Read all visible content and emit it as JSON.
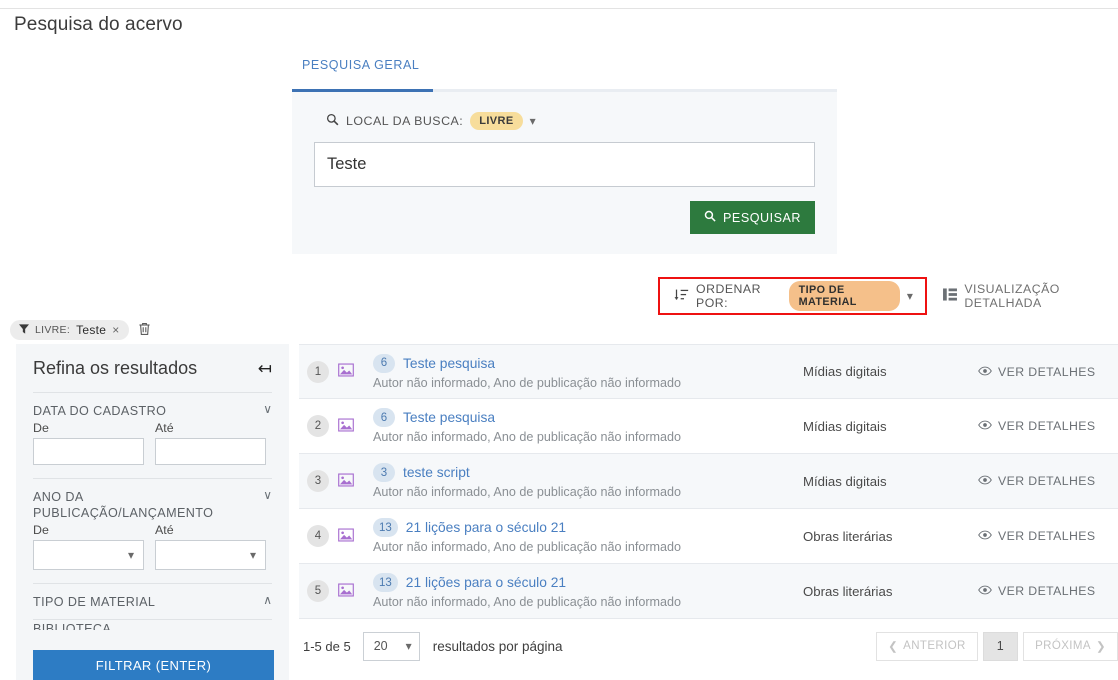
{
  "page": {
    "title": "Pesquisa do acervo"
  },
  "search": {
    "tabs": [
      {
        "label": "PESQUISA GERAL",
        "active": true
      }
    ],
    "local_label": "LOCAL DA BUSCA:",
    "local_value": "LIVRE",
    "query_value": "Teste",
    "submit_label": "PESQUISAR"
  },
  "sortbar": {
    "order_label": "ORDENAR POR:",
    "order_value": "TIPO DE MATERIAL",
    "view_label": "VISUALIZAÇÃO DETALHADA",
    "highlight_color": "#ee1111"
  },
  "applied_filter": {
    "key": "LIVRE:",
    "value": "Teste",
    "remove": "×",
    "clear_all_icon": "trash-icon"
  },
  "sidebar": {
    "title": "Refina os resultados",
    "facets": [
      {
        "title": "DATA DO CADASTRO",
        "state": "expanded",
        "chevron": "∨",
        "from_label": "De",
        "to_label": "Até",
        "from_value": "",
        "to_value": "",
        "type": "date"
      },
      {
        "title": "ANO DA PUBLICAÇÃO/LANÇAMENTO",
        "state": "expanded",
        "chevron": "∨",
        "from_label": "De",
        "to_label": "Até",
        "from_value": "",
        "to_value": "",
        "type": "select"
      },
      {
        "title": "TIPO DE MATERIAL",
        "state": "collapsed-up",
        "chevron": "∧",
        "type": "list",
        "clipped_item": "BIBLIOTECA"
      }
    ],
    "filter_button": "FILTRAR (ENTER)",
    "accent_color": "#2d7cc4"
  },
  "results": {
    "details_label": "VER DETALHES",
    "rows": [
      {
        "n": "1",
        "count": "6",
        "title": "Teste pesquisa",
        "sub": "Autor não informado, Ano de publicação não informado",
        "type": "Mídias digitais",
        "icon": "image-icon"
      },
      {
        "n": "2",
        "count": "6",
        "title": "Teste pesquisa",
        "sub": "Autor não informado, Ano de publicação não informado",
        "type": "Mídias digitais",
        "icon": "image-icon"
      },
      {
        "n": "3",
        "count": "3",
        "title": "teste script",
        "sub": "Autor não informado, Ano de publicação não informado",
        "type": "Mídias digitais",
        "icon": "image-icon"
      },
      {
        "n": "4",
        "count": "13",
        "title": "21 lições para o século 21",
        "sub": "Autor não informado, Ano de publicação não informado",
        "type": "Obras literárias",
        "icon": "image-icon"
      },
      {
        "n": "5",
        "count": "13",
        "title": "21 lições para o século 21",
        "sub": "Autor não informado, Ano de publicação não informado",
        "type": "Obras literárias",
        "icon": "image-icon"
      }
    ]
  },
  "pagination": {
    "range": "1-5 de 5",
    "per_page_value": "20",
    "per_page_label": "resultados por página",
    "prev": "ANTERIOR",
    "current": "1",
    "next": "PRÓXIMA"
  }
}
